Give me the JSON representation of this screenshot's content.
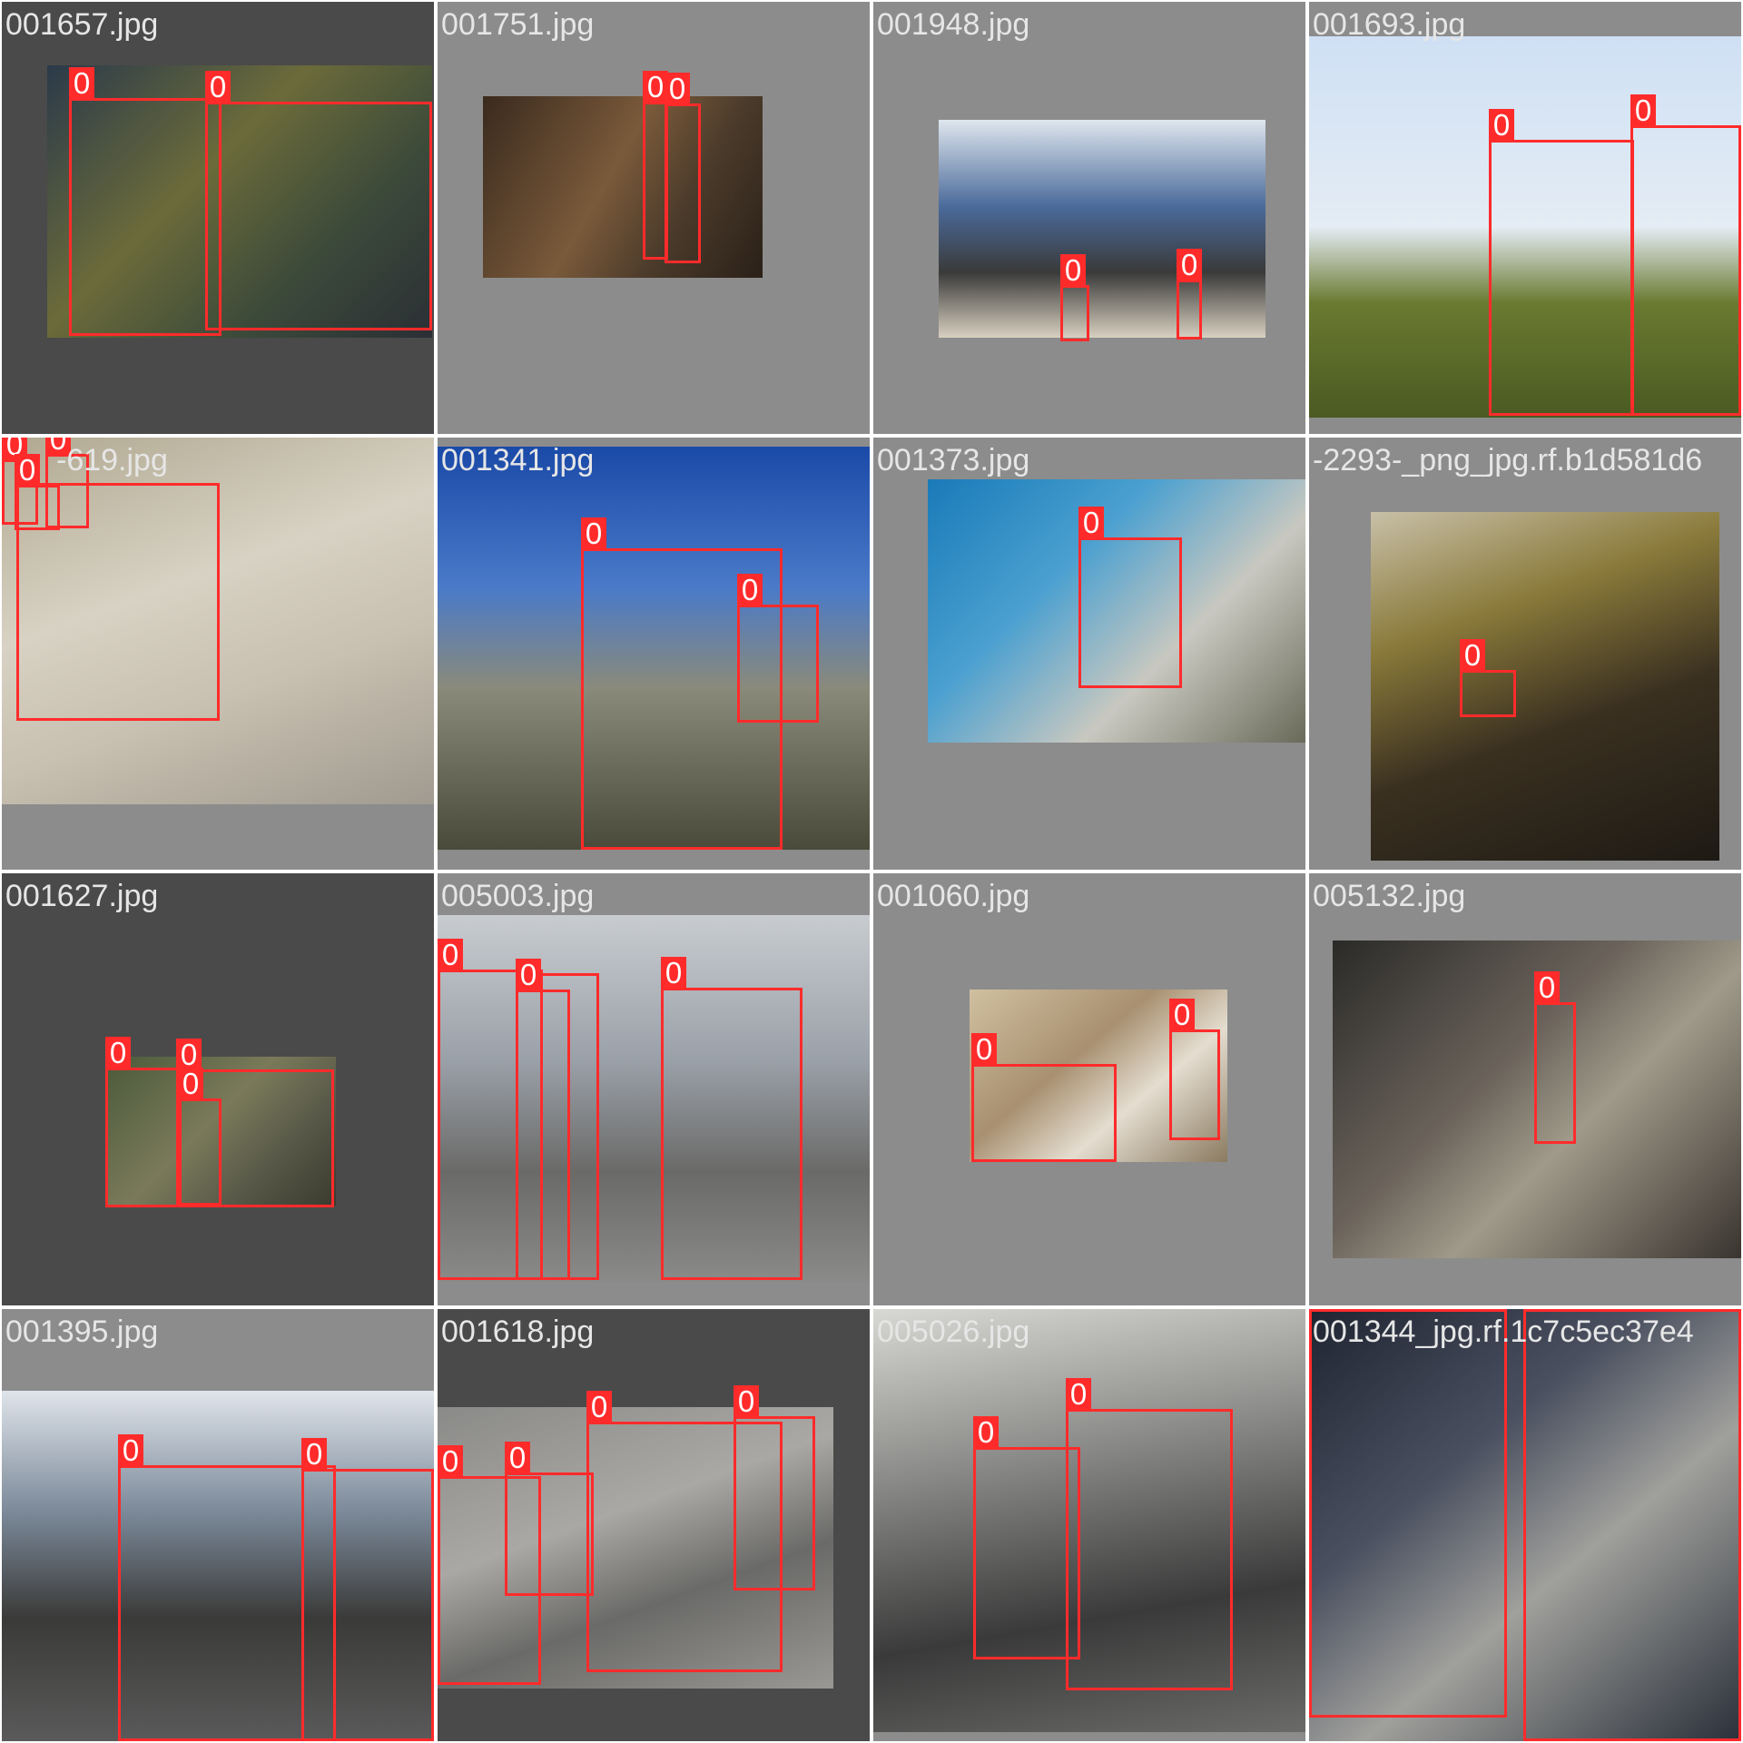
{
  "class_label": "0",
  "colors": {
    "box": "#ff2b2b",
    "label_text": "#ffffff",
    "filename_text": "#e6e6e6"
  },
  "tiles": [
    {
      "filename": "001657.jpg",
      "boxes": 2
    },
    {
      "filename": "001751.jpg",
      "boxes": 2
    },
    {
      "filename": "001948.jpg",
      "boxes": 2
    },
    {
      "filename": "001693.jpg",
      "boxes": 2
    },
    {
      "filename": "-619.jpg",
      "boxes": 3
    },
    {
      "filename": "001341.jpg",
      "boxes": 2
    },
    {
      "filename": "001373.jpg",
      "boxes": 1
    },
    {
      "filename": "-2293-_png_jpg.rf.b1d581d6",
      "boxes": 1
    },
    {
      "filename": "001627.jpg",
      "boxes": 3
    },
    {
      "filename": "005003.jpg",
      "boxes": 3
    },
    {
      "filename": "001060.jpg",
      "boxes": 2
    },
    {
      "filename": "005132.jpg",
      "boxes": 1
    },
    {
      "filename": "001395.jpg",
      "boxes": 2
    },
    {
      "filename": "001618.jpg",
      "boxes": 4
    },
    {
      "filename": "005026.jpg",
      "boxes": 2
    },
    {
      "filename": "001344_jpg.rf.1c7c5ec37e4",
      "boxes": 2
    }
  ]
}
